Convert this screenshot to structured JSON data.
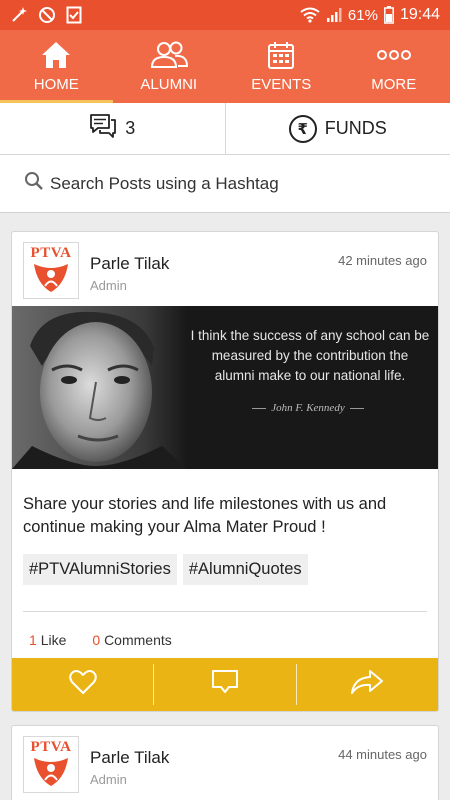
{
  "status_bar": {
    "battery": "61%",
    "time": "19:44",
    "icons": [
      "magic-wand-icon",
      "no-disturb-icon",
      "checklist-icon",
      "wifi-icon",
      "signal-icon",
      "battery-icon"
    ]
  },
  "nav": {
    "items": [
      {
        "label": "HOME",
        "icon": "home-icon",
        "active": true
      },
      {
        "label": "ALUMNI",
        "icon": "people-icon",
        "active": false
      },
      {
        "label": "EVENTS",
        "icon": "calendar-icon",
        "active": false
      },
      {
        "label": "MORE",
        "icon": "more-dots-icon",
        "active": false
      }
    ]
  },
  "counters": {
    "messages": "3",
    "funds_label": "FUNDS",
    "funds_symbol": "₹"
  },
  "search": {
    "placeholder": "Search Posts using a Hashtag"
  },
  "posts": [
    {
      "author": "Parle Tilak",
      "role": "Admin",
      "time": "42 minutes ago",
      "logo_text": "PTVA",
      "image": {
        "quote": "I think the success of any school can be measured by the contribution the alumni make to our national life.",
        "attribution": "John F. Kennedy"
      },
      "text": "Share your stories and life milestones with us and continue making your Alma Mater Proud !",
      "tags": [
        "#PTVAlumniStories",
        "#AlumniQuotes"
      ],
      "likes_count": "1",
      "likes_label": "Like",
      "comments_count": "0",
      "comments_label": "Comments"
    },
    {
      "author": "Parle Tilak",
      "role": "Admin",
      "time": "44 minutes ago",
      "logo_text": "PTVA"
    }
  ],
  "colors": {
    "status_bar": "#e8502e",
    "nav_bar": "#f06a48",
    "nav_active_indicator": "#f4c45a",
    "action_bar": "#eab414",
    "accent_number": "#e8502e"
  }
}
